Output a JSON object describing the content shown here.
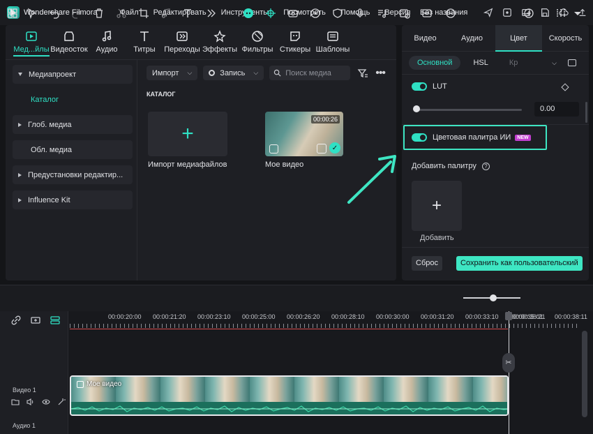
{
  "app": {
    "name": "Wondershare Filmora",
    "project": "Без названия"
  },
  "menu": [
    "Файл",
    "Редактировать",
    "Инструменты",
    "Посмотреть",
    "Помощь",
    "Версия"
  ],
  "media_tabs": [
    "Мед...йлы",
    "Видеосток",
    "Аудио",
    "Титры",
    "Переходы",
    "Эффекты",
    "Фильтры",
    "Стикеры",
    "Шаблоны"
  ],
  "sidebar": {
    "items": [
      {
        "label": "Медиапроект"
      },
      {
        "label": "Каталог"
      },
      {
        "label": "Глоб. медиа"
      },
      {
        "label": "Обл. медиа"
      },
      {
        "label": "Предустановки редактир..."
      },
      {
        "label": "Influence Kit"
      }
    ]
  },
  "media_toolbar": {
    "import_label": "Импорт",
    "record_label": "Запись",
    "search_placeholder": "Поиск медиа"
  },
  "catalog": {
    "title": "КАТАЛОГ",
    "import_card_label": "Импорт медиафайлов",
    "video": {
      "name": "Мое видео",
      "duration": "00:00:26"
    }
  },
  "right_panel": {
    "tabs": [
      "Видео",
      "Аудио",
      "Цвет",
      "Скорость"
    ],
    "subtabs": [
      "Основной",
      "HSL",
      "Кр"
    ],
    "lut_label": "LUT",
    "lut_value": "0.00",
    "ai_palette_label": "Цветовая палитра ИИ",
    "new_badge": "NEW",
    "add_palette_label": "Добавить палитру",
    "add_label": "Добавить",
    "reset_label": "Сброс",
    "save_label": "Сохранить как пользовательский"
  },
  "timeline": {
    "ruler": [
      "00:00:20:00",
      "00:00:21:20",
      "00:00:23:10",
      "00:00:25:00",
      "00:00:26:20",
      "00:00:28:10",
      "00:00:30:00",
      "00:00:31:20",
      "00:00:33:10",
      "00:00:35:01",
      "00:00:36:21",
      "00:00:38:11"
    ],
    "video_track": "Видео 1",
    "audio_track": "Аудио 1",
    "clip_name": "Мое видео"
  },
  "colors": {
    "accent": "#2fe0c4",
    "background": "#141518",
    "panel": "#1e1f24"
  }
}
